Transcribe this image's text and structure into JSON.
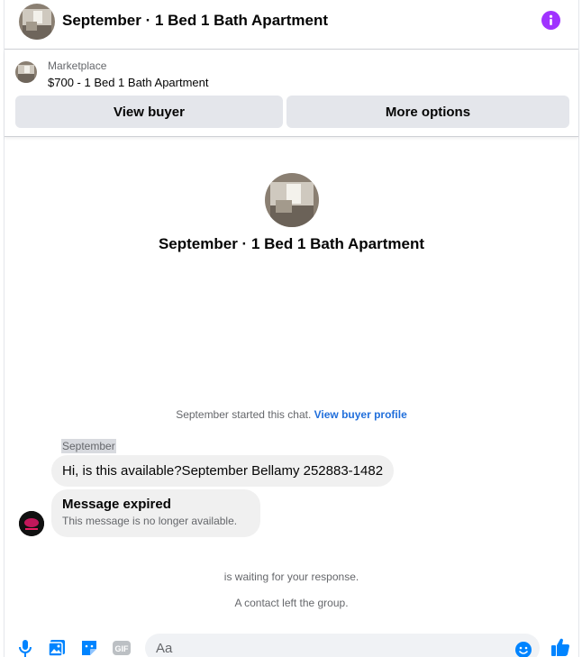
{
  "header": {
    "title": "September · 1 Bed 1 Bath Apartment"
  },
  "marketplace": {
    "label": "Marketplace",
    "listing": "$700 - 1 Bed 1 Bath Apartment",
    "view_buyer": "View buyer",
    "more_options": "More options"
  },
  "intro": {
    "title": "September · 1 Bed 1 Bath Apartment"
  },
  "system": {
    "started_text": "September started this chat.",
    "view_profile_link": "View buyer profile",
    "waiting": "is waiting for your response.",
    "contact_left": "A contact left the group."
  },
  "messages": {
    "sender": "September",
    "first": "Hi, is this available?September Bellamy 252883-1482",
    "expired_title": "Message expired",
    "expired_sub": "This message is no longer available."
  },
  "composer": {
    "placeholder": "Aa",
    "gif_label": "GIF"
  },
  "colors": {
    "accent": "#0084ff",
    "info": "#a033ff",
    "link": "#216fdb"
  },
  "icons": [
    "info-icon",
    "microphone-icon",
    "photo-icon",
    "sticker-icon",
    "gif-icon",
    "emoji-icon",
    "thumbs-up-icon"
  ]
}
